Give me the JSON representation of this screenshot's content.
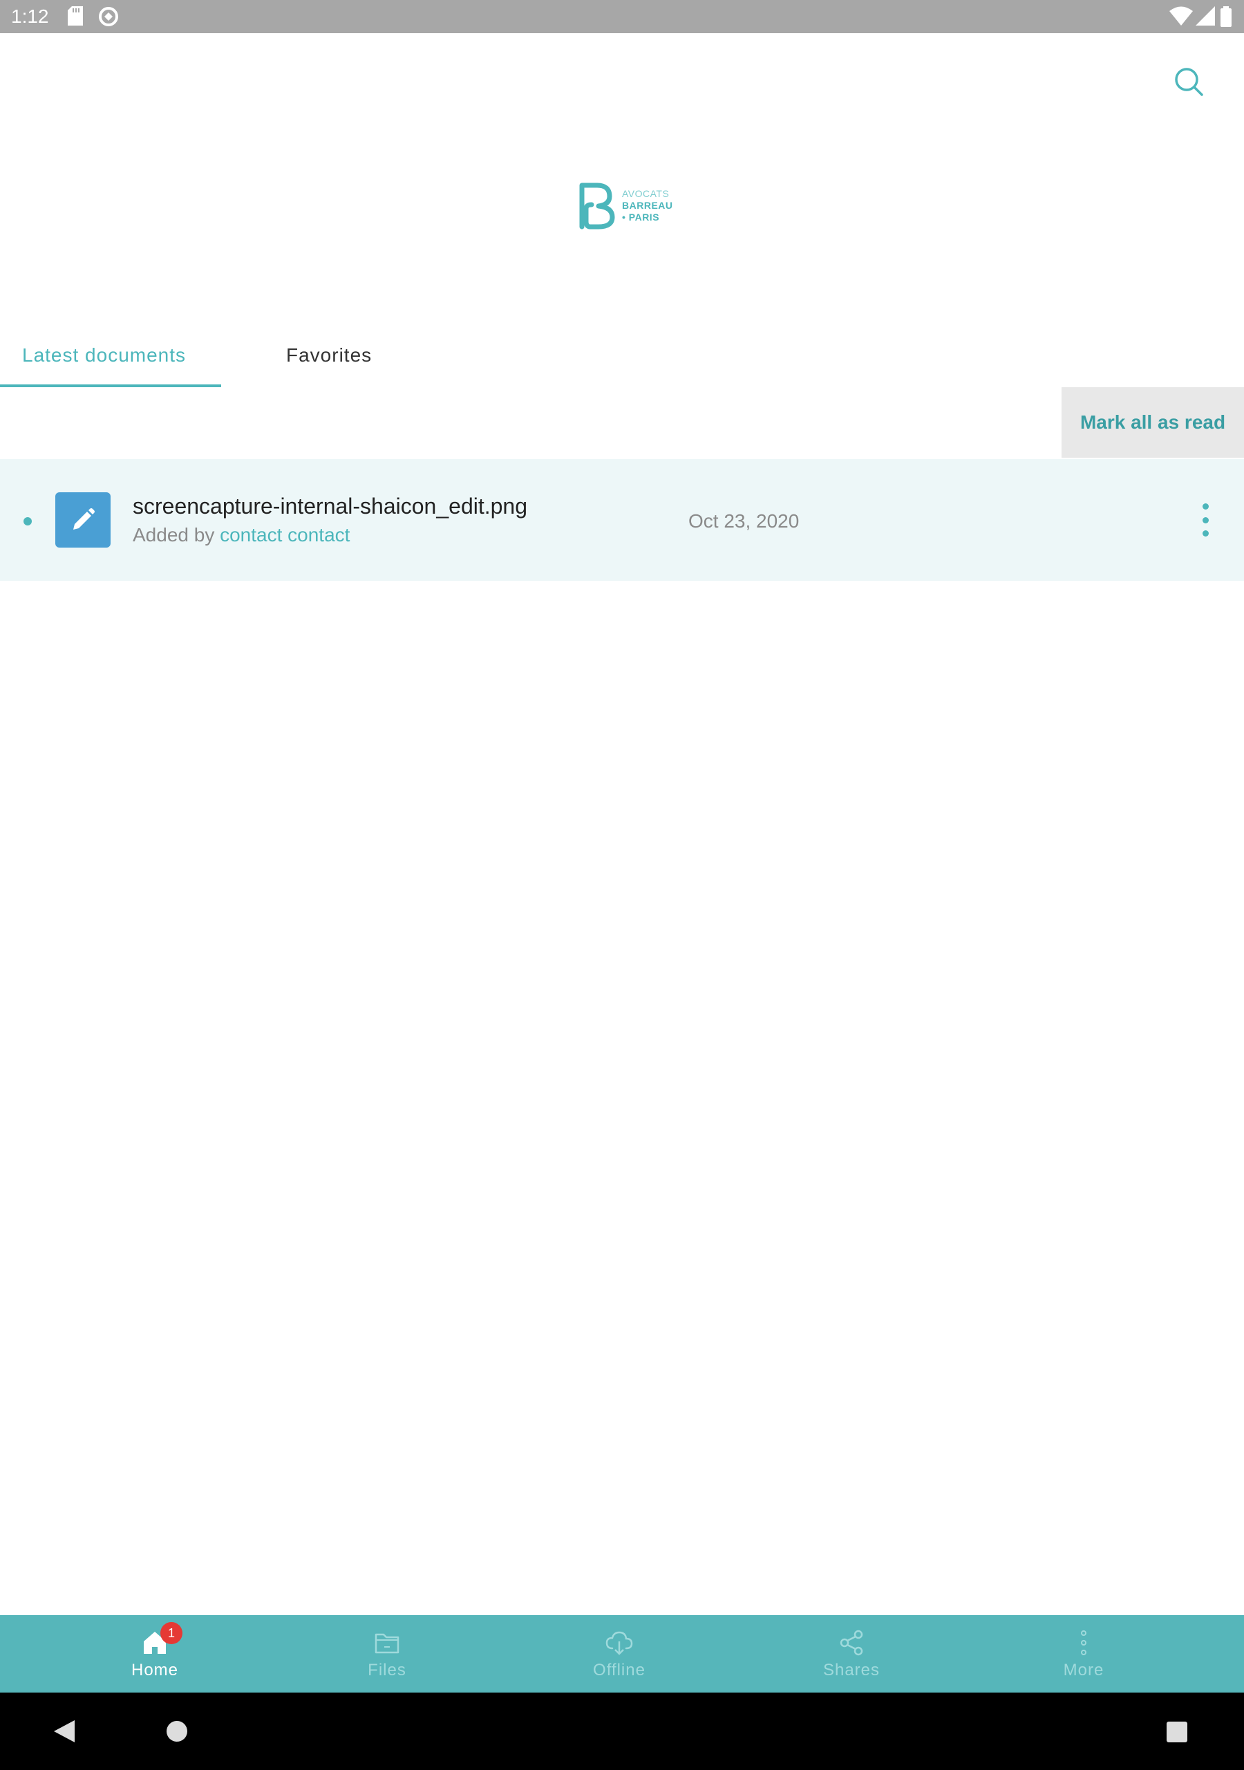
{
  "status_bar": {
    "time": "1:12"
  },
  "header": {
    "logo": {
      "line1": "AVOCATS",
      "line2": "BARREAU",
      "line3": "• PARIS"
    }
  },
  "tabs": [
    {
      "label": "Latest documents",
      "active": true
    },
    {
      "label": "Favorites",
      "active": false
    }
  ],
  "mark_all_read_label": "Mark all as read",
  "documents": [
    {
      "name": "screencapture-internal-shaicon_edit.png",
      "added_by_prefix": "Added by",
      "author": "contact contact",
      "date": "Oct 23, 2020",
      "unread": true,
      "icon": "pencil-icon"
    }
  ],
  "bottom_nav": [
    {
      "label": "Home",
      "icon": "home-icon",
      "active": true,
      "badge": "1"
    },
    {
      "label": "Files",
      "icon": "folder-icon",
      "active": false
    },
    {
      "label": "Offline",
      "icon": "cloud-download-icon",
      "active": false
    },
    {
      "label": "Shares",
      "icon": "share-icon",
      "active": false
    },
    {
      "label": "More",
      "icon": "more-vertical-icon",
      "active": false
    }
  ],
  "colors": {
    "accent": "#4cb6bb",
    "nav_background": "#56b6ba",
    "row_highlight": "#edf7f8",
    "badge": "#e53935"
  }
}
